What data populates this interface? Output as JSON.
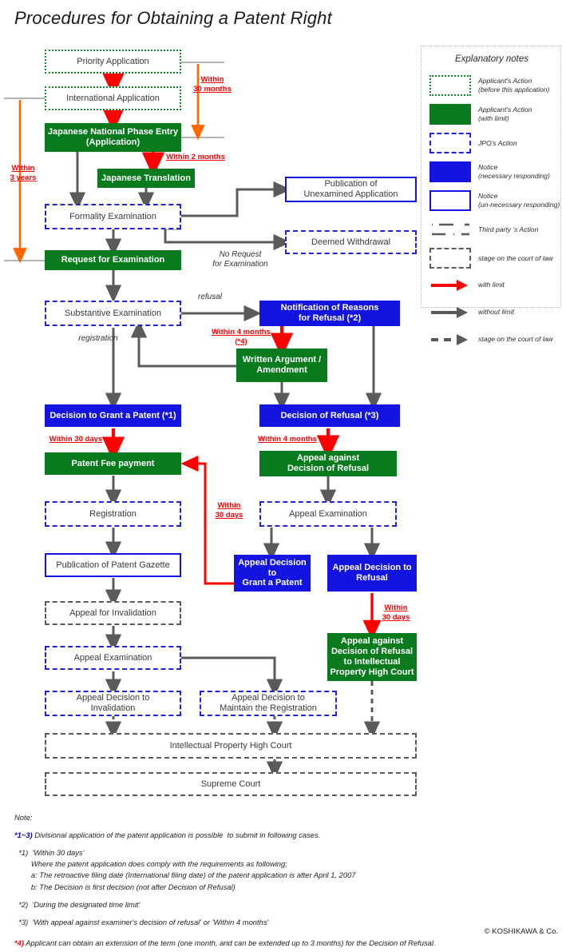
{
  "title": "Procedures for Obtaining a Patent Right",
  "colors": {
    "applicant_green": "#0a7a1e",
    "notice_blue": "#1414e0",
    "jpo_dash_blue": "#2222dd",
    "with_limit_red": "#ff0000",
    "without_limit_gray": "#5a5a5a",
    "orange_bracket": "#ff6600"
  },
  "boxes": {
    "priority_application": "Priority Application",
    "international_application": "International Application",
    "japanese_national_phase_entry": "Japanese National Phase Entry\n(Application)",
    "japanese_translation": "Japanese Translation",
    "formality_examination": "Formality Examination",
    "publication_of_unexamined_application": "Publication of\nUnexamined Application",
    "deemed_withdrawal": "Deemed Withdrawal",
    "request_for_examination": "Request for Examination",
    "substantive_examination": "Substantive Examination",
    "notification_of_reasons_for_refusal": "Notification of Reasons\nfor Refusal (*2)",
    "written_argument_amendment": "Written Argument /\nAmendment",
    "decision_to_grant_a_patent": "Decision to Grant a Patent (*1)",
    "decision_of_refusal": "Decision of Refusal (*3)",
    "patent_fee_payment": "Patent Fee payment",
    "appeal_against_decision_of_refusal": "Appeal against\nDecision of Refusal",
    "registration": "Registration",
    "appeal_examination_upper": "Appeal Examination",
    "publication_of_patent_gazette": "Publication of Patent Gazette",
    "appeal_decision_to_grant_a_patent": "Appeal Decision to\nGrant a Patent",
    "appeal_decision_to_refusal": "Appeal Decision to\nRefusal",
    "appeal_for_invalidation": "Appeal for Invalidation",
    "appeal_against_decision_to_ip_high_court": "Appeal against\nDecision of Refusal\nto Intellectual\nProperty High Court",
    "appeal_examination_lower": "Appeal Examination",
    "appeal_decision_to_invalidation": "Appeal Decision to\nInvalidation",
    "appeal_decision_to_maintain": "Appeal Decision to\nMaintain the Registration",
    "intellectual_property_high_court": "Intellectual Property High Court",
    "supreme_court": "Supreme Court"
  },
  "edge_labels": {
    "within_30_months": "Within\n30 months",
    "within_3_years": "Within\n3 years",
    "within_2_months": "Within 2 months",
    "no_request_for_examination": "No Request\nfor Examination",
    "refusal": "refusal",
    "registration": "registration",
    "within_4_months_4": "Within 4 months\n(*4)",
    "within_30_days_grant": "Within 30 days",
    "within_4_months_refusal": "Within 4 months",
    "within_30_days_loop": "Within\n30 days",
    "within_30_days_court": "Within\n30 days"
  },
  "legend": {
    "title": "Explanatory notes",
    "items": [
      {
        "swatch": "applicant-action-before",
        "text": "Applicant's Action\n (before this application)"
      },
      {
        "swatch": "applicant-action-limit",
        "text": "Applicant's Action\n(with limit)"
      },
      {
        "swatch": "jpo-action",
        "text": "JPO's Action"
      },
      {
        "swatch": "notice-necessary",
        "text": "Notice\n(necessary responding)"
      },
      {
        "swatch": "notice-unnecessary",
        "text": "Notice\n(un-necessary responding)"
      },
      {
        "swatch": "third-party-action",
        "text": "Third party 's Action"
      },
      {
        "swatch": "stage-court-box",
        "text": "stage on the court of law"
      },
      {
        "swatch": "arrow-with-limit",
        "text": "with limit"
      },
      {
        "swatch": "arrow-without-limit",
        "text": "without limit"
      },
      {
        "swatch": "arrow-stage-court",
        "text": "stage on the court of law"
      }
    ]
  },
  "notes": {
    "heading": "Note:",
    "star13_mark": "*1~3)",
    "star13_text": " Divisional application of the patent application is possible  to submit in following cases.",
    "star1_l1": "  *1)  'Within 30 days'",
    "star1_l2": "        Where the patent application does comply with the requirements as following;",
    "star1_l3": "        a: The retroactive filing date (International filing date) of the patent application is after April 1, 2007",
    "star1_l4": "        b: The Decision is first decision (not after Decision of Refusal)",
    "star2": "  *2)  'During the designated time limit'",
    "star3": "  *3)  'With appeal against examiner's decision of refusal' or 'Within 4 months'",
    "star4_mark": "*4)",
    "star4_text": " Applicant can obtain an extension of the term (one month, and can be extended up to 3 months) for the Decision of Refusal.",
    "copyright": "© KOSHIKAWA & Co."
  }
}
